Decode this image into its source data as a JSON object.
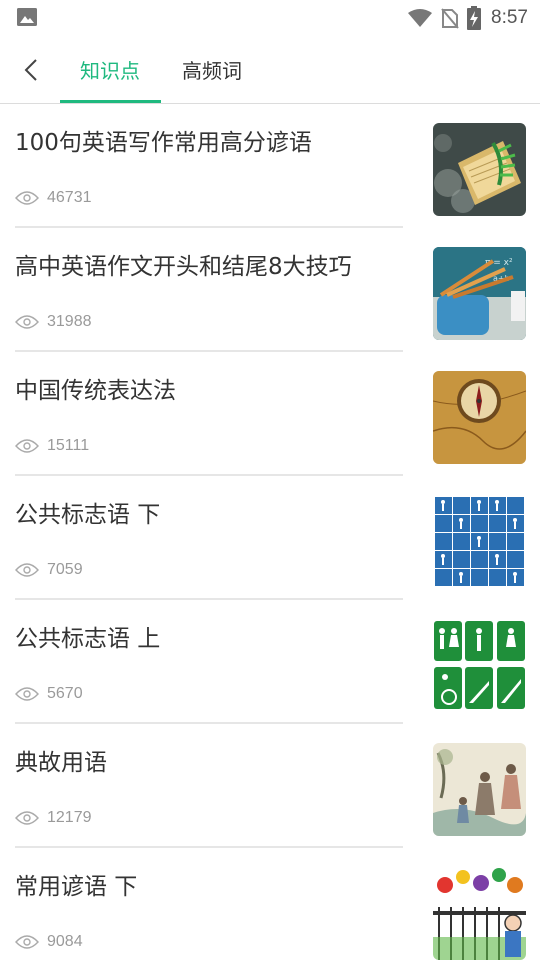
{
  "status_bar": {
    "time": "8:57",
    "icons": [
      "image-icon",
      "wifi-icon",
      "no-sim-icon",
      "battery-charging-icon"
    ]
  },
  "header": {
    "back_icon": "chevron-left-icon",
    "tabs": [
      {
        "label": "知识点",
        "active": true
      },
      {
        "label": "高频词",
        "active": false
      }
    ]
  },
  "colors": {
    "accent": "#1fb97f",
    "text": "#333333",
    "muted": "#9a9a9a"
  },
  "items": [
    {
      "title": "100句英语写作常用高分谚语",
      "views": "46731",
      "thumbnail": "book-with-leaves"
    },
    {
      "title": "高中英语作文开头和结尾8大技巧",
      "views": "31988",
      "thumbnail": "pencils-and-chalkboard"
    },
    {
      "title": "中国传统表达法",
      "views": "15111",
      "thumbnail": "compass-on-map"
    },
    {
      "title": "公共标志语 下",
      "views": "7059",
      "thumbnail": "blue-public-signs"
    },
    {
      "title": "公共标志语 上",
      "views": "5670",
      "thumbnail": "green-public-signs"
    },
    {
      "title": "典故用语",
      "views": "12179",
      "thumbnail": "ink-painting-figures"
    },
    {
      "title": "常用谚语 下",
      "views": "9084",
      "thumbnail": "colorful-cartoon"
    }
  ]
}
